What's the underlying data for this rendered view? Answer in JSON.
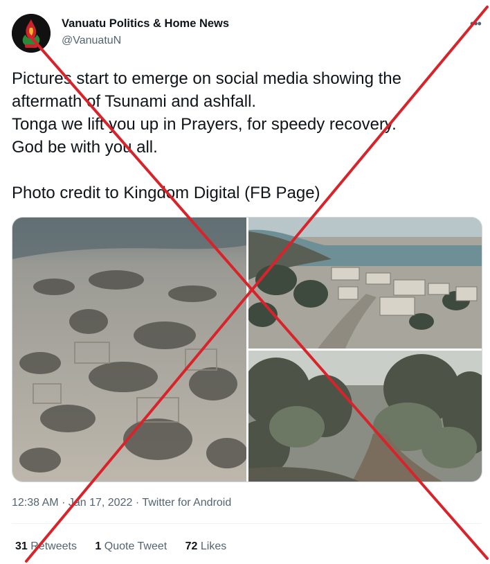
{
  "tweet": {
    "author_name": "Vanuatu Politics & Home News",
    "author_handle": "@VanuatuN",
    "more_icon": "more-horizontal-icon",
    "text_lines": [
      "Pictures start to emerge on social media showing the",
      "aftermath of Tsunami and ashfall.",
      "Tonga we lift you up in Prayers, for speedy recovery.",
      "God be with you all."
    ],
    "credit_line": "Photo credit to Kingdom Digital (FB Page)",
    "time": "12:38 AM",
    "date": "Jan 17, 2022",
    "source": "Twitter for Android",
    "separator": "·"
  },
  "stats": {
    "retweets_count": "31",
    "retweets_label": "Retweets",
    "quotes_count": "1",
    "quotes_label": "Quote Tweet",
    "likes_count": "72",
    "likes_label": "Likes"
  },
  "overlay": {
    "color": "#d8232a"
  }
}
